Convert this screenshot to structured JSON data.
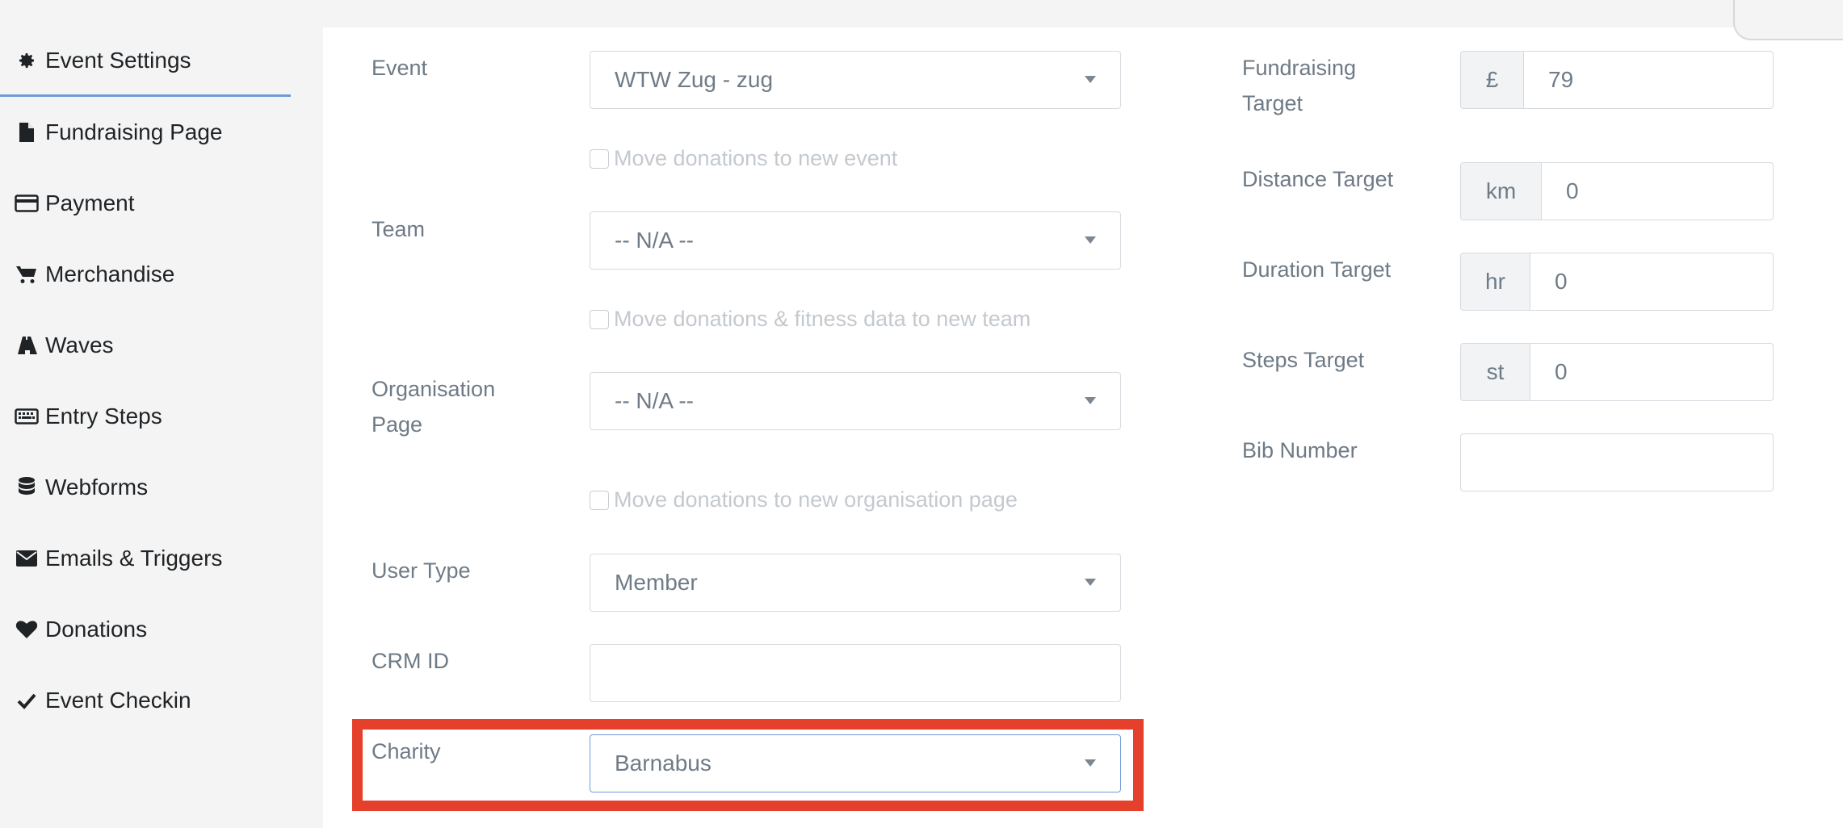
{
  "sidebar": {
    "items": [
      {
        "label": "Event Settings",
        "icon": "gear-icon"
      },
      {
        "label": "Fundraising Page",
        "icon": "file-icon"
      },
      {
        "label": "Payment",
        "icon": "credit-card-icon"
      },
      {
        "label": "Merchandise",
        "icon": "cart-icon"
      },
      {
        "label": "Waves",
        "icon": "road-icon"
      },
      {
        "label": "Entry Steps",
        "icon": "keyboard-icon"
      },
      {
        "label": "Webforms",
        "icon": "database-icon"
      },
      {
        "label": "Emails & Triggers",
        "icon": "envelope-icon"
      },
      {
        "label": "Donations",
        "icon": "heart-icon"
      },
      {
        "label": "Event Checkin",
        "icon": "check-icon"
      }
    ],
    "active_index": 0
  },
  "form": {
    "event": {
      "label": "Event",
      "value": "WTW Zug - zug"
    },
    "move_event": {
      "label": "Move donations to new event"
    },
    "team": {
      "label": "Team",
      "value": "-- N/A --"
    },
    "move_team": {
      "label": "Move donations & fitness data to new team"
    },
    "organisation": {
      "label_line1": "Organisation",
      "label_line2": "Page",
      "value": "-- N/A --"
    },
    "move_org": {
      "label": "Move donations to new organisation page"
    },
    "user_type": {
      "label": "User Type",
      "value": "Member"
    },
    "crm_id": {
      "label": "CRM ID",
      "value": ""
    },
    "charity": {
      "label": "Charity",
      "value": "Barnabus"
    }
  },
  "targets": {
    "fundraising": {
      "label_line1": "Fundraising",
      "label_line2": "Target",
      "addon": "£",
      "value": "79"
    },
    "distance": {
      "label": "Distance Target",
      "addon": "km",
      "value": "0"
    },
    "duration": {
      "label": "Duration Target",
      "addon": "hr",
      "value": "0"
    },
    "steps": {
      "label": "Steps Target",
      "addon": "st",
      "value": "0"
    },
    "bib": {
      "label": "Bib Number",
      "value": ""
    }
  },
  "colors": {
    "highlight": "#e5402b",
    "active_underline": "#6f9ad9"
  }
}
